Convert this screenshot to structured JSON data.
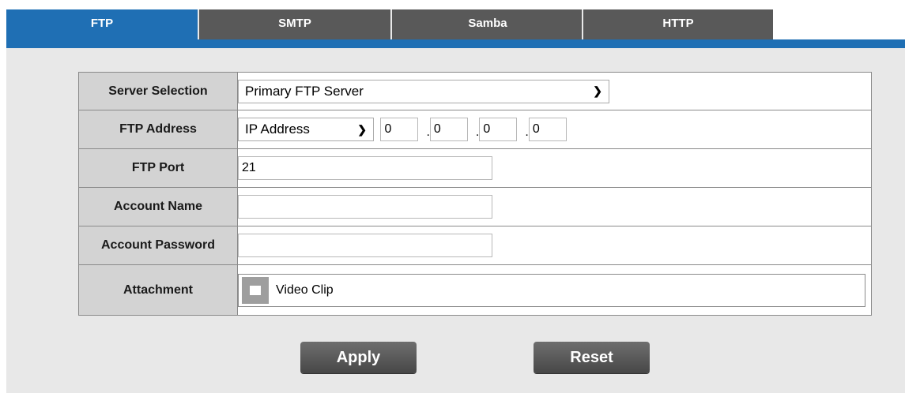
{
  "tabs": [
    {
      "label": "FTP",
      "active": true
    },
    {
      "label": "SMTP",
      "active": false
    },
    {
      "label": "Samba",
      "active": false
    },
    {
      "label": "HTTP",
      "active": false
    }
  ],
  "form": {
    "server_selection": {
      "label": "Server Selection",
      "value": "Primary FTP Server"
    },
    "ftp_address": {
      "label": "FTP Address",
      "type_value": "IP Address",
      "octets": [
        "0",
        "0",
        "0",
        "0"
      ]
    },
    "ftp_port": {
      "label": "FTP Port",
      "value": "21"
    },
    "account_name": {
      "label": "Account Name",
      "value": ""
    },
    "account_password": {
      "label": "Account Password",
      "value": ""
    },
    "attachment": {
      "label": "Attachment",
      "option_label": "Video Clip",
      "checked": false
    }
  },
  "buttons": {
    "apply": "Apply",
    "reset": "Reset"
  },
  "colors": {
    "accent": "#1f6fb4",
    "tab_inactive": "#595959",
    "panel": "#e8e8e8"
  }
}
